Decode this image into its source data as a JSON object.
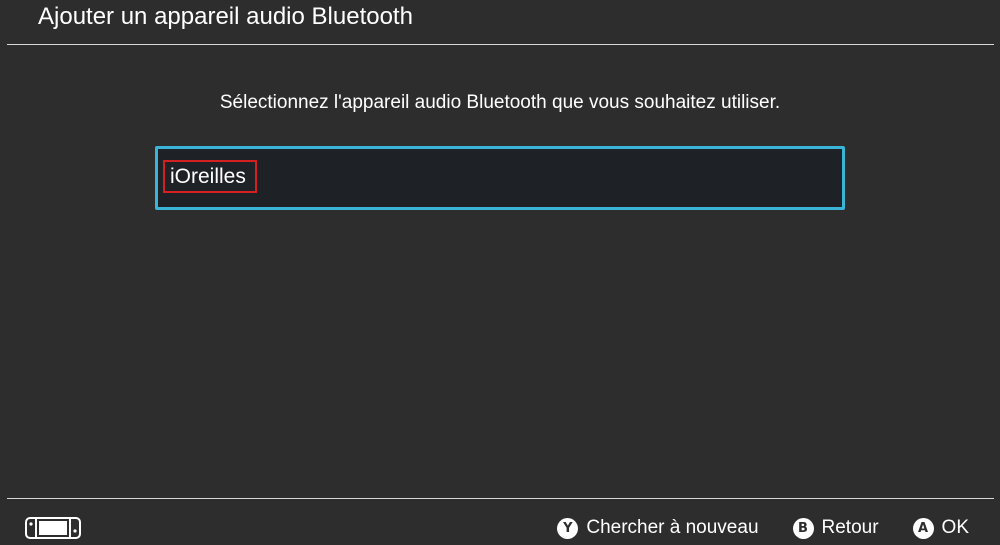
{
  "header": {
    "title": "Ajouter un appareil audio Bluetooth"
  },
  "main": {
    "instruction": "Sélectionnez l'appareil audio Bluetooth que vous souhaitez utiliser.",
    "devices": [
      {
        "name": "iOreilles",
        "selected": true
      }
    ]
  },
  "footer": {
    "console_icon": "handheld-console-icon",
    "actions": [
      {
        "glyph": "Y",
        "label": "Chercher à nouveau"
      },
      {
        "glyph": "B",
        "label": "Retour"
      },
      {
        "glyph": "A",
        "label": "OK"
      }
    ]
  },
  "colors": {
    "background": "#2d2d2d",
    "selection_border": "#3ab5d8",
    "item_background": "#1e2126",
    "highlight_box": "#d42020",
    "text": "#ffffff"
  }
}
